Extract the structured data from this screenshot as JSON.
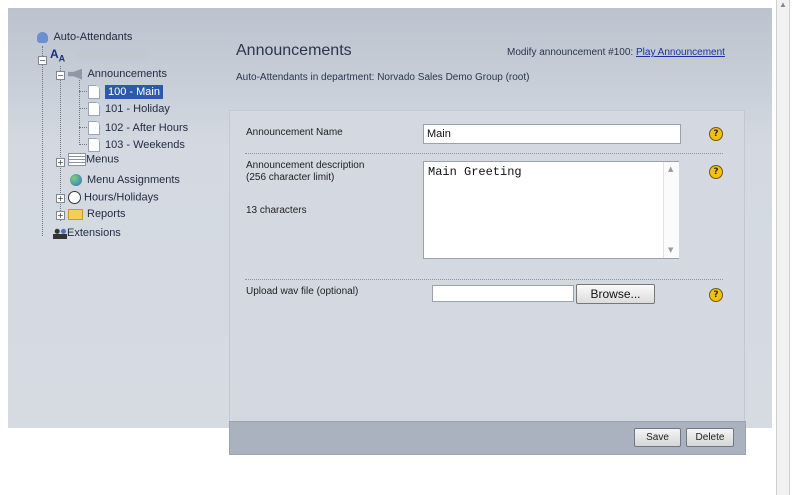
{
  "tree": {
    "root_label": "Auto-Attendants",
    "announcements_label": "Announcements",
    "items": [
      {
        "label": "100 - Main",
        "selected": true
      },
      {
        "label": "101 - Holiday"
      },
      {
        "label": "102 - After Hours"
      },
      {
        "label": "103 - Weekends"
      }
    ],
    "menus_label": "Menus",
    "menu_assignments_label": "Menu Assignments",
    "hours_label": "Hours/Holidays",
    "reports_label": "Reports",
    "extensions_label": "Extensions"
  },
  "header": {
    "title": "Announcements",
    "modify_text": "Modify announcement #100:",
    "play_link": "Play Announcement",
    "dept_text": "Auto-Attendants in department: Norvado Sales Demo Group (root)"
  },
  "form": {
    "name_label": "Announcement Name",
    "name_value": "Main",
    "desc_label_line1": "Announcement description",
    "desc_label_line2": "(256 character limit)",
    "char_count": "13 characters",
    "desc_value": "Main Greeting",
    "upload_label": "Upload wav file (optional)",
    "browse_label": "Browse...",
    "help_glyph": "?"
  },
  "footer": {
    "save_label": "Save",
    "delete_label": "Delete"
  },
  "colors": {
    "selected_bg": "#2d5aa8",
    "link": "#1a33a0",
    "help_icon": "#f2c012"
  }
}
